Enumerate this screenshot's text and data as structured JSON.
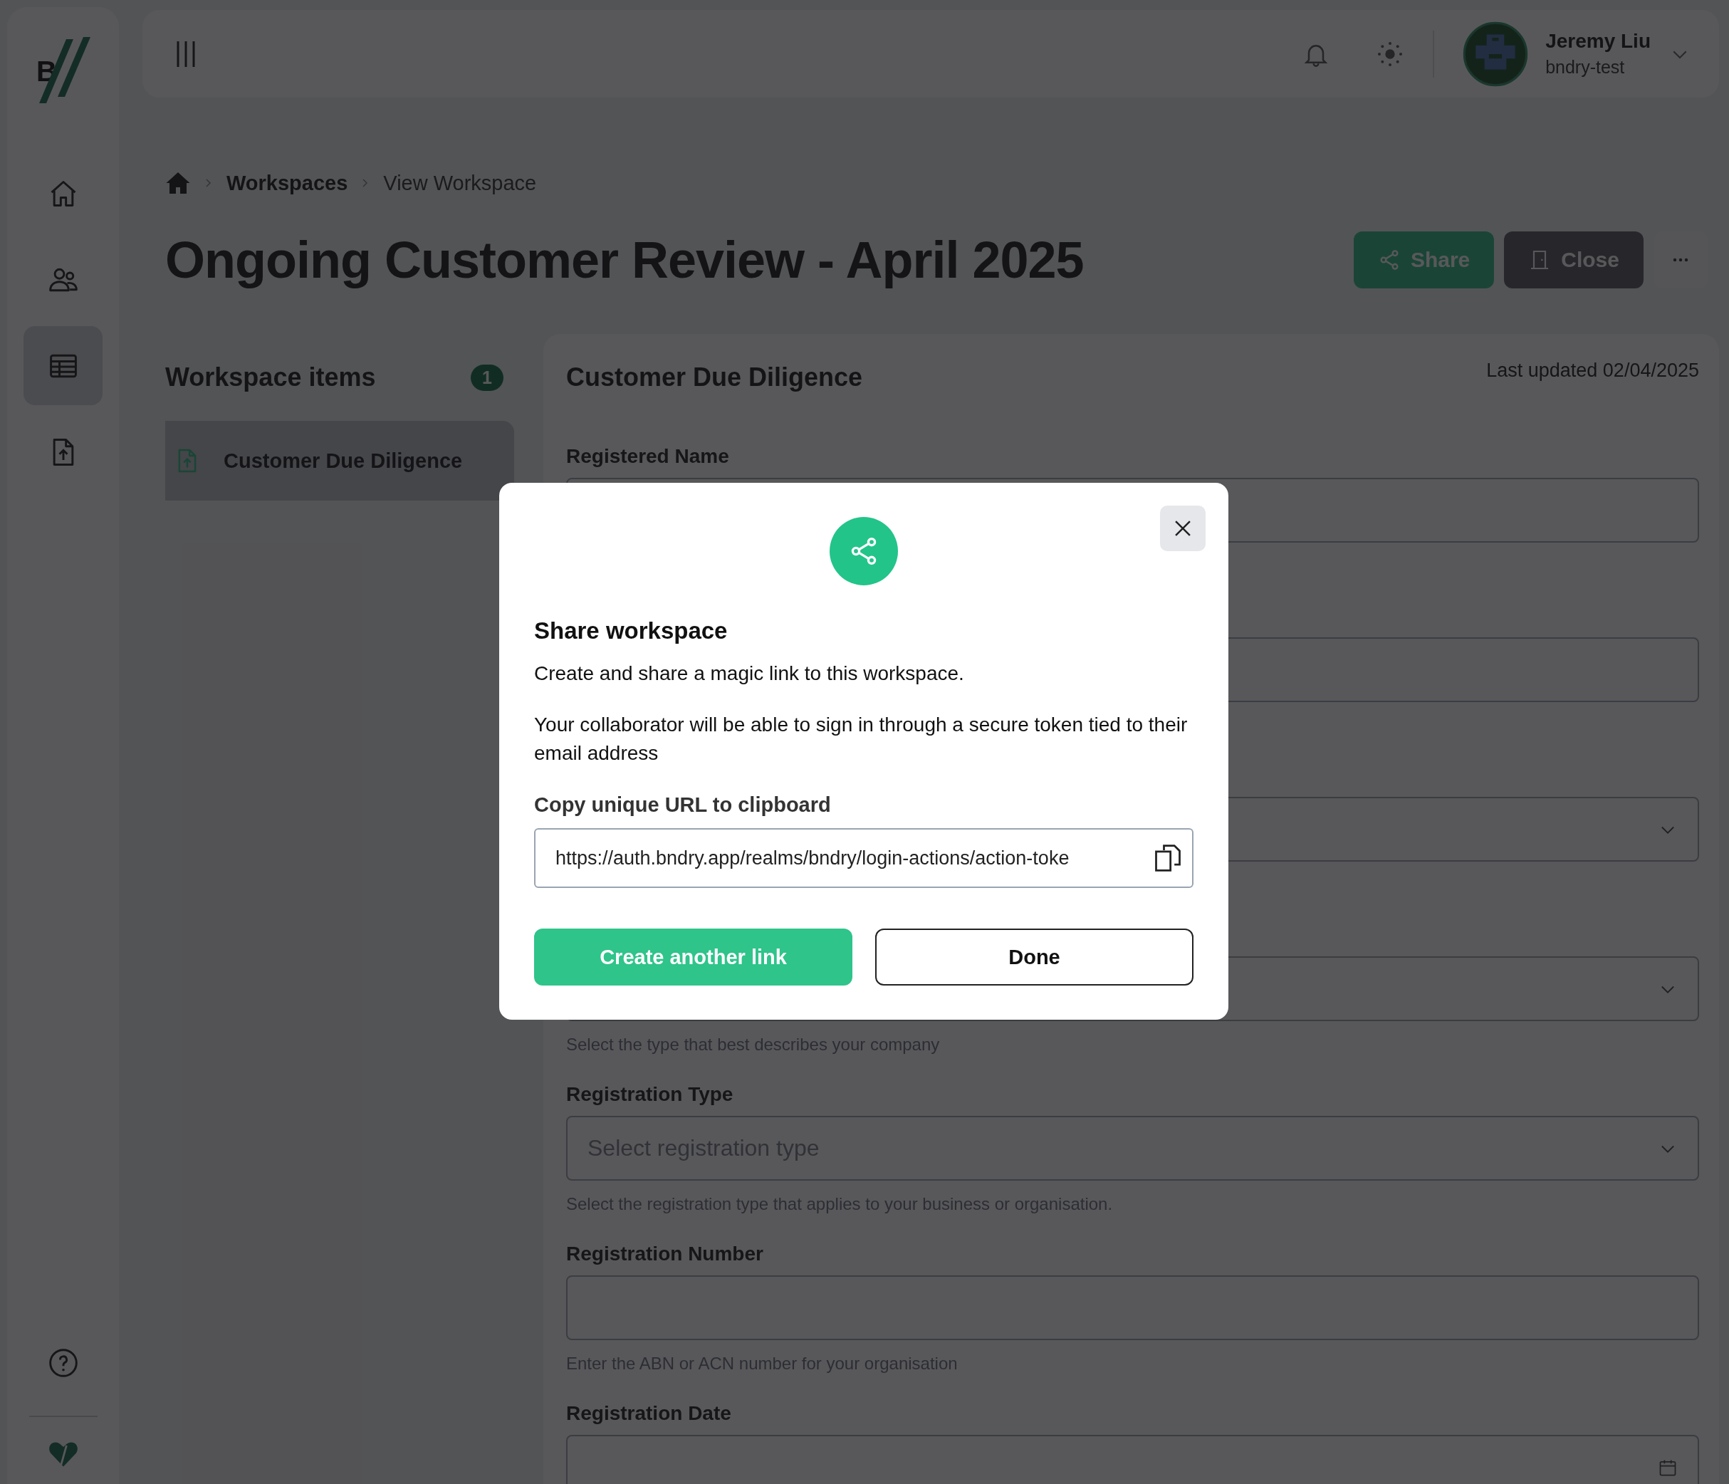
{
  "sidebar": {
    "logo": {
      "text": "B"
    },
    "items": [
      {
        "kind": "home",
        "selected": false
      },
      {
        "kind": "people",
        "selected": false
      },
      {
        "kind": "table",
        "selected": true
      },
      {
        "kind": "upload",
        "selected": false
      }
    ],
    "footer": [
      {
        "kind": "help"
      }
    ]
  },
  "header": {
    "user": {
      "name": "Jeremy Liu",
      "org": "bndry-test"
    }
  },
  "breadcrumb": [
    {
      "label": "Workspaces",
      "current": false
    },
    {
      "label": "View Workspace",
      "current": true
    }
  ],
  "page_title": "Ongoing Customer Review - April 2025",
  "actions": [
    {
      "kind": "share",
      "label": "Share"
    },
    {
      "kind": "close",
      "label": "Close"
    },
    {
      "kind": "more"
    }
  ],
  "workspace_items": {
    "title": "Workspace items",
    "count": "1",
    "items": [
      {
        "label": "Customer Due Diligence",
        "selected": true
      }
    ]
  },
  "form": {
    "title": "Customer Due Diligence",
    "last_updated": "Last updated 02/04/2025",
    "fields": [
      {
        "kind": "text",
        "label": "Registered Name"
      },
      {
        "kind": "text"
      },
      {
        "kind": "select"
      },
      {
        "kind": "select",
        "help": "Select the type that best describes your company"
      },
      {
        "kind": "select",
        "label": "Registration Type",
        "placeholder": "Select registration type",
        "help": "Select the registration type that applies to your business or organisation."
      },
      {
        "kind": "text",
        "label": "Registration Number",
        "help": "Enter the ABN or ACN number for your organisation"
      },
      {
        "kind": "date",
        "label": "Registration Date"
      }
    ]
  },
  "dialog": {
    "title": "Share workspace",
    "paragraphs": [
      "Create and share a magic link to this workspace.",
      "Your collaborator will be able to sign in through a secure token tied to their email address"
    ],
    "url_label": "Copy unique URL to clipboard",
    "url": "https://auth.bndry.app/realms/bndry/login-actions/action-toke",
    "buttons": [
      {
        "kind": "primary",
        "label": "Create another link"
      },
      {
        "kind": "secondary",
        "label": "Done"
      }
    ]
  }
}
